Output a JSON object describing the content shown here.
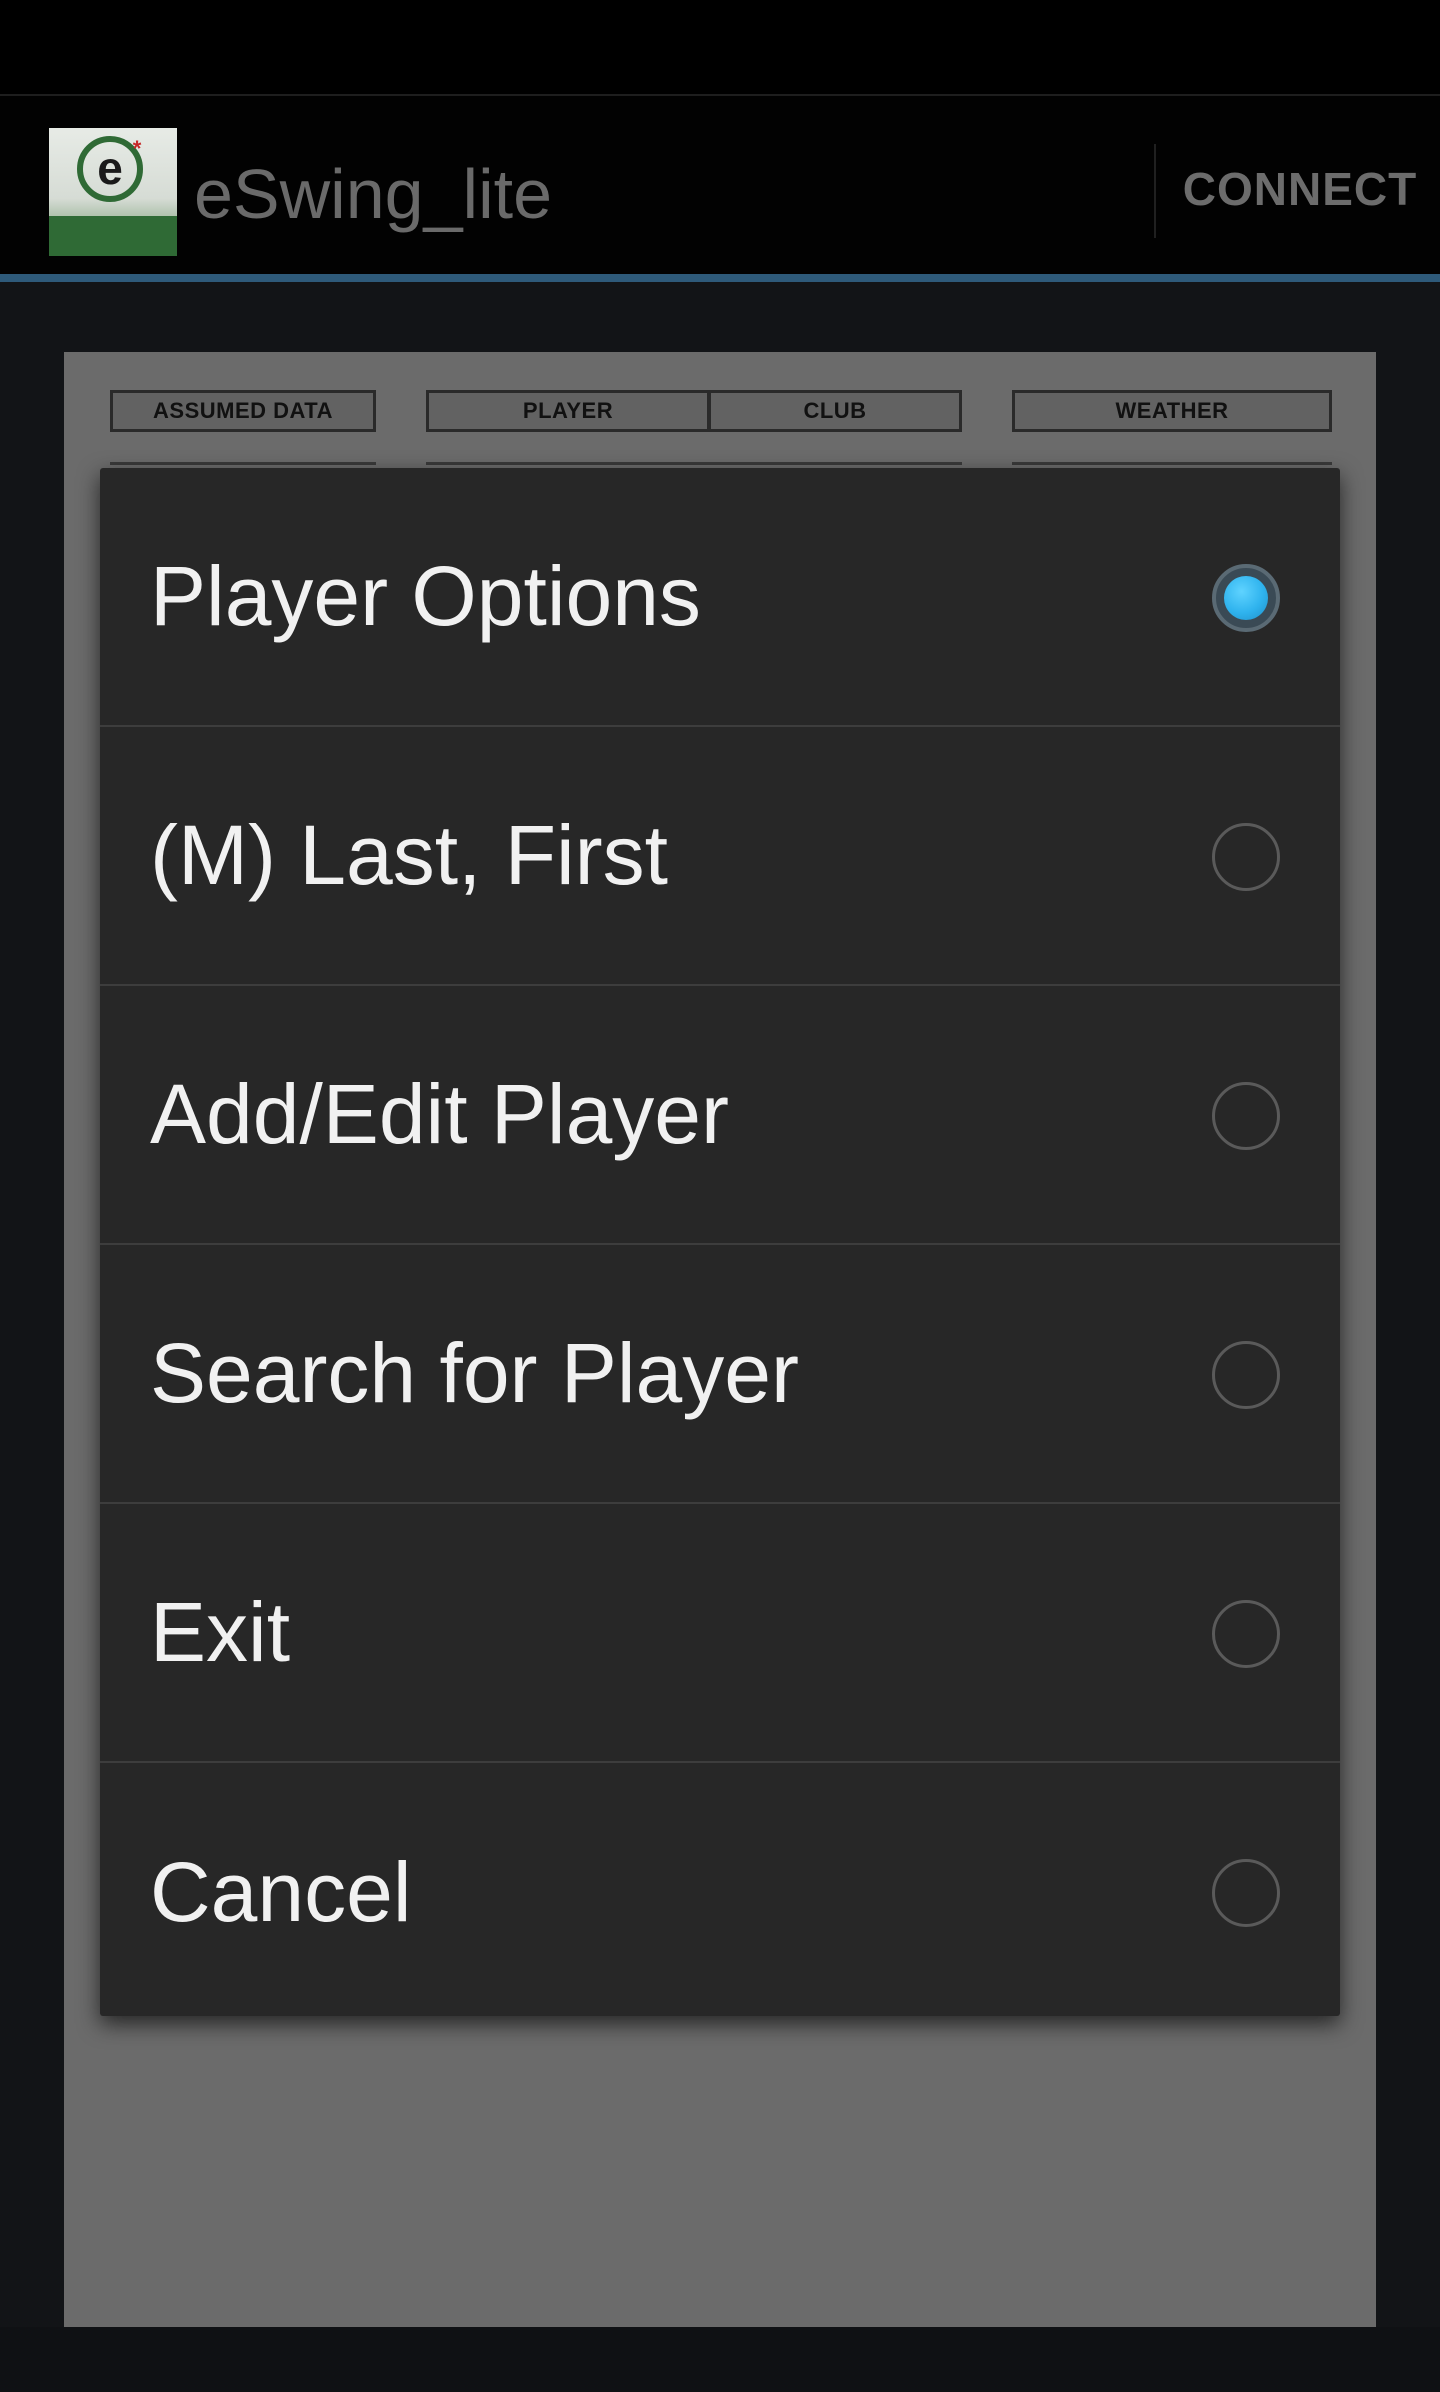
{
  "actionbar": {
    "app_title": "eSwing_lite",
    "connect_label": "CONNECT",
    "logo_icon": "eswing-logo-icon",
    "accent_color": "#2e5a7a"
  },
  "tabs": {
    "assumed_data": "ASSUMED DATA",
    "player": "PLAYER",
    "club": "CLUB",
    "weather": "WEATHER"
  },
  "dialog": {
    "options": [
      {
        "label": "Player Options",
        "selected": true
      },
      {
        "label": "(M) Last, First",
        "selected": false
      },
      {
        "label": "Add/Edit Player",
        "selected": false
      },
      {
        "label": "Search for Player",
        "selected": false
      },
      {
        "label": "Exit",
        "selected": false
      },
      {
        "label": "Cancel",
        "selected": false
      }
    ],
    "selected_color": "#2fb3ee"
  }
}
